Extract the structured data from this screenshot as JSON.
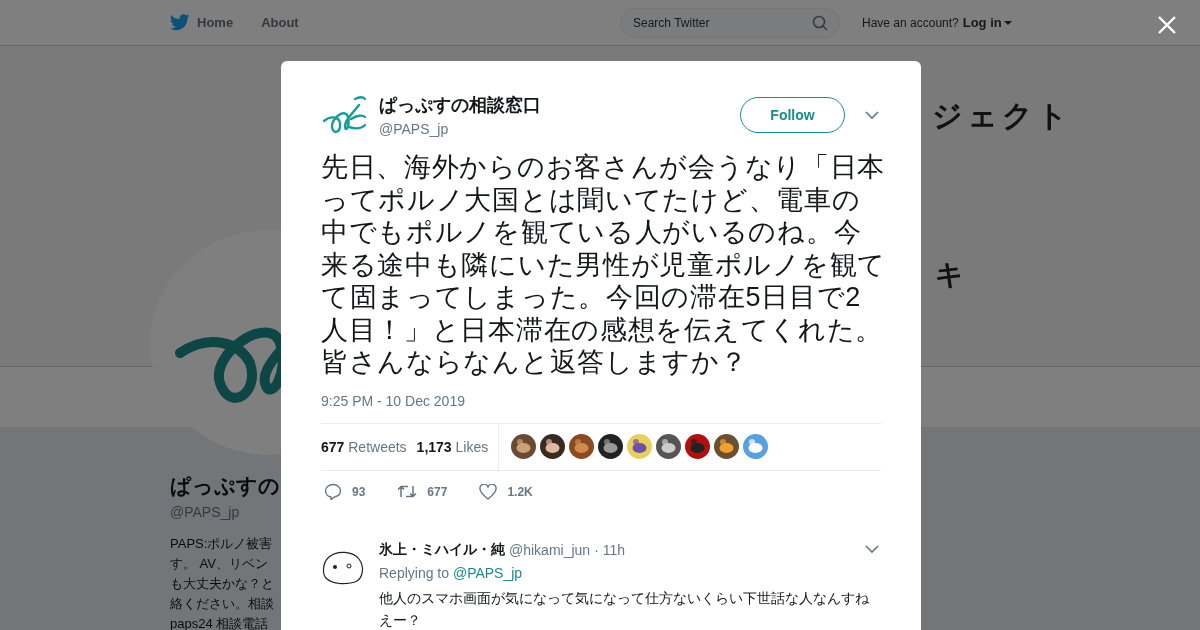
{
  "top_bar": {
    "nav_items": [
      {
        "label": "Home",
        "kind": "home"
      },
      {
        "label": "About",
        "kind": "plain"
      }
    ],
    "search": {
      "placeholder": "Search Twitter"
    },
    "account_prompt": "Have an account?",
    "login_label": "Log in"
  },
  "background_profile": {
    "banner_texts": [
      "ジェクト",
      "キ"
    ],
    "name": "ぱっぷすの",
    "handle": "@PAPS_jp",
    "bio_lines": [
      "PAPS:ポルノ被害",
      "す。 AV、リベン",
      "も大丈夫かな？と",
      "絡ください。相談",
      "paps24 相談電話"
    ]
  },
  "tweet": {
    "author_name": "ぱっぷすの相談窓口",
    "handle": "@PAPS_jp",
    "follow_label": "Follow",
    "text": "先日、海外からのお客さんが会うなり「日本ってポルノ大国とは聞いてたけど、電車の中でもポルノを観ている人がいるのね。今来る途中も隣にいた男性が児童ポルノを観てて固まってしまった。今回の滞在5日目で2人目！」と日本滞在の感想を伝えてくれた。皆さんならなんと返答しますか？",
    "timestamp": "9:25 PM - 10 Dec 2019",
    "retweets_count": "677",
    "retweets_label": "Retweets",
    "likes_count": "1,173",
    "likes_label": "Likes",
    "actions": [
      {
        "kind": "reply",
        "count": "93"
      },
      {
        "kind": "retweet",
        "count": "677"
      },
      {
        "kind": "like",
        "count": "1.2K"
      }
    ]
  },
  "reply": {
    "author_name": "氷上・ミハイル・純",
    "handle": "@hikami_jun",
    "time_separator": "·",
    "time": "11h",
    "replying_prefix": "Replying to",
    "replying_handle": "@PAPS_jp",
    "text": "他人のスマホ画面が気になって気になって仕方ないくらい下世話な人なんすねえー？"
  }
}
